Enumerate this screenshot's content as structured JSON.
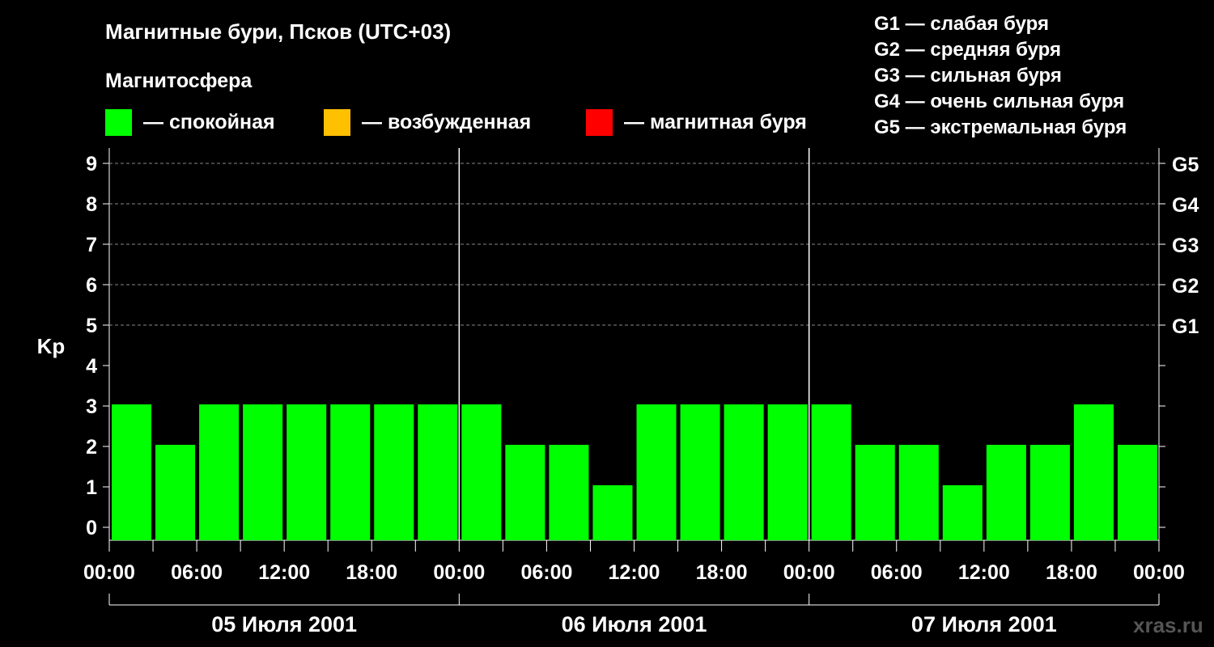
{
  "title": "Магнитные бури, Псков (UTC+03)",
  "subtitle": "Магнитосфера",
  "legend": [
    {
      "label": "— спокойная",
      "color": "#00ff00"
    },
    {
      "label": "— возбужденная",
      "color": "#ffc000"
    },
    {
      "label": "— магнитная буря",
      "color": "#ff0000"
    }
  ],
  "g_legend": [
    "G1 — слабая буря",
    "G2 — средняя буря",
    "G3 — сильная буря",
    "G4 — очень сильная буря",
    "G5 — экстремальная буря"
  ],
  "watermark": "xras.ru",
  "chart_data": {
    "type": "bar",
    "title": "Магнитные бури, Псков (UTC+03)",
    "ylabel": "Kp",
    "ylim": [
      0,
      9
    ],
    "y_ticks": [
      "0",
      "1",
      "2",
      "3",
      "4",
      "5",
      "6",
      "7",
      "8",
      "9"
    ],
    "right_ticks": [
      {
        "value": 5,
        "label": "G1"
      },
      {
        "value": 6,
        "label": "G2"
      },
      {
        "value": 7,
        "label": "G3"
      },
      {
        "value": 8,
        "label": "G4"
      },
      {
        "value": 9,
        "label": "G5"
      }
    ],
    "x_tick_labels": [
      "00:00",
      "06:00",
      "12:00",
      "18:00",
      "00:00",
      "06:00",
      "12:00",
      "18:00",
      "00:00",
      "06:00",
      "12:00",
      "18:00",
      "00:00"
    ],
    "days": [
      "05 Июля 2001",
      "06 Июля 2001",
      "07 Июля 2001"
    ],
    "bar_color": "#00ff00",
    "grid": "dashed horizontal at 5–9",
    "values": [
      3,
      2,
      3,
      3,
      3,
      3,
      3,
      3,
      3,
      2,
      2,
      1,
      3,
      3,
      3,
      3,
      3,
      2,
      2,
      1,
      2,
      2,
      3,
      2
    ]
  }
}
